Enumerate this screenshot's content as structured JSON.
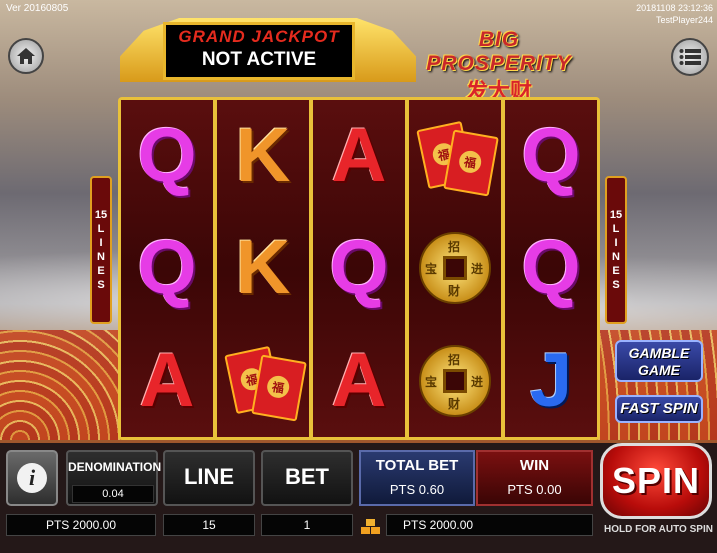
{
  "header": {
    "version": "Ver 20160805",
    "datetime": "20181108 23:12:36",
    "player": "TestPlayer244"
  },
  "jackpot": {
    "title": "GRAND JACKPOT",
    "status": "NOT ACTIVE"
  },
  "logo": {
    "english": "BIG PROSPERITY",
    "chinese": "发大财"
  },
  "lines_indicator": {
    "count": "15",
    "letters": [
      "L",
      "I",
      "N",
      "E",
      "S"
    ]
  },
  "reels": [
    [
      "Q",
      "Q",
      "A"
    ],
    [
      "K",
      "K",
      "red-envelope"
    ],
    [
      "A",
      "Q",
      "A"
    ],
    [
      "red-envelope",
      "gold-coin",
      "gold-coin"
    ],
    [
      "Q",
      "Q",
      "J"
    ]
  ],
  "reel_chars": {
    "Q": "Q",
    "K": "K",
    "A": "A",
    "J": "J",
    "envelope_glyph": "福",
    "coin_glyphs": [
      "招",
      "进",
      "财",
      "宝"
    ]
  },
  "side_buttons": {
    "gamble_line1": "GAMBLE",
    "gamble_line2": "GAME",
    "fast_spin": "FAST SPIN"
  },
  "panel": {
    "denomination_label": "DENOMINATION",
    "denomination_value": "0.04",
    "line_label": "LINE",
    "bet_label": "BET",
    "total_bet_label": "TOTAL BET",
    "total_bet_value": "PTS 0.60",
    "win_label": "WIN",
    "win_value": "PTS 0.00",
    "balance_value": "PTS 2000.00",
    "line_value": "15",
    "bet_value": "1",
    "credit_value": "PTS 2000.00",
    "spin_label": "SPIN",
    "hold_label": "HOLD FOR AUTO SPIN"
  },
  "colors": {
    "reel_frame": "#e9c13a",
    "reel_bg": "#3b0606",
    "spin_red": "#d81e22",
    "jackpot_red": "#e52b1e"
  }
}
